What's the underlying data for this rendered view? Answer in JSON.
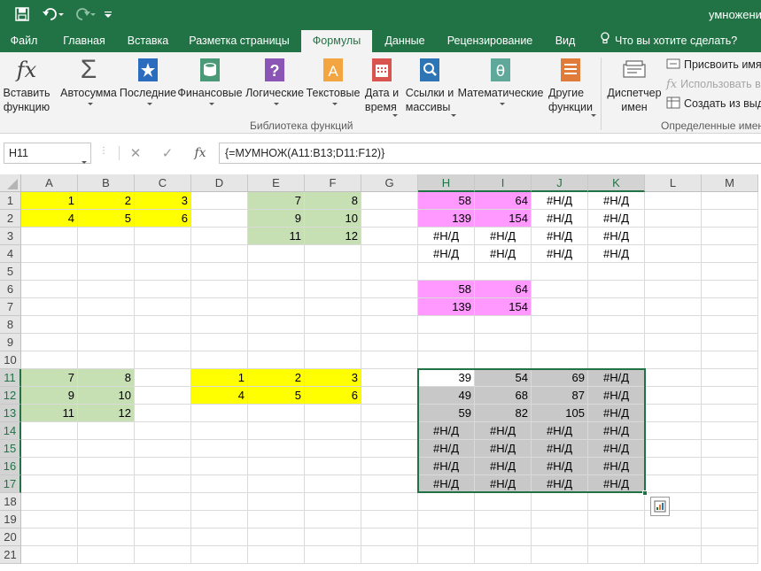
{
  "titlebar": {
    "doc_title": "умножени"
  },
  "tabs": [
    "Файл",
    "Главная",
    "Вставка",
    "Разметка страницы",
    "Формулы",
    "Данные",
    "Рецензирование",
    "Вид"
  ],
  "active_tab": "Формулы",
  "tell_me": "Что вы хотите сделать?",
  "ribbon": {
    "insert_function": "Вставить\nфункцию",
    "buttons": [
      {
        "id": "autosum",
        "label": "Автосумма",
        "icon": "sigma-icon"
      },
      {
        "id": "recent",
        "label": "Последние",
        "icon": "star-book-icon"
      },
      {
        "id": "financial",
        "label": "Финансовые",
        "icon": "coins-book-icon"
      },
      {
        "id": "logical",
        "label": "Логические",
        "icon": "question-book-icon"
      },
      {
        "id": "text",
        "label": "Текстовые",
        "icon": "letter-book-icon"
      },
      {
        "id": "datetime",
        "label": "Дата и\nвремя",
        "icon": "calendar-book-icon"
      },
      {
        "id": "lookup",
        "label": "Ссылки и\nмассивы",
        "icon": "magnifier-book-icon"
      },
      {
        "id": "math",
        "label": "Математические",
        "icon": "theta-book-icon"
      },
      {
        "id": "more",
        "label": "Другие\nфункции",
        "icon": "more-book-icon"
      }
    ],
    "library_group_label": "Библиотека функций",
    "name_manager": "Диспетчер\nимен",
    "define_name": "Присвоить имя",
    "use_in_formula": "Использовать в",
    "create_from_selection": "Создать из выде",
    "defined_names_group_label": "Определенные имена"
  },
  "formula_bar": {
    "name_box": "H11",
    "cancel_symbol": "✕",
    "enter_symbol": "✓",
    "fx_symbol": "fx",
    "formula": "{=МУМНОЖ(A11:B13;D11:F12)}"
  },
  "sheet": {
    "columns": [
      "A",
      "B",
      "C",
      "D",
      "E",
      "F",
      "G",
      "H",
      "I",
      "J",
      "K",
      "L",
      "M"
    ],
    "rows": [
      "1",
      "2",
      "3",
      "4",
      "5",
      "6",
      "7",
      "8",
      "9",
      "10",
      "11",
      "12",
      "13",
      "14",
      "15",
      "16",
      "17",
      "18",
      "19",
      "20",
      "21"
    ],
    "selected_columns": [
      "H",
      "I",
      "J",
      "K"
    ],
    "selected_rows": [
      "11",
      "12",
      "13",
      "14",
      "15",
      "16",
      "17"
    ],
    "cells": [
      {
        "ref": "A1",
        "v": "1",
        "fill": "yellow"
      },
      {
        "ref": "B1",
        "v": "2",
        "fill": "yellow"
      },
      {
        "ref": "C1",
        "v": "3",
        "fill": "yellow"
      },
      {
        "ref": "A2",
        "v": "4",
        "fill": "yellow"
      },
      {
        "ref": "B2",
        "v": "5",
        "fill": "yellow"
      },
      {
        "ref": "C2",
        "v": "6",
        "fill": "yellow"
      },
      {
        "ref": "E1",
        "v": "7",
        "fill": "green"
      },
      {
        "ref": "F1",
        "v": "8",
        "fill": "green"
      },
      {
        "ref": "E2",
        "v": "9",
        "fill": "green"
      },
      {
        "ref": "F2",
        "v": "10",
        "fill": "green"
      },
      {
        "ref": "E3",
        "v": "11",
        "fill": "green"
      },
      {
        "ref": "F3",
        "v": "12",
        "fill": "green"
      },
      {
        "ref": "H1",
        "v": "58",
        "fill": "pink"
      },
      {
        "ref": "I1",
        "v": "64",
        "fill": "pink"
      },
      {
        "ref": "J1",
        "v": "#Н/Д"
      },
      {
        "ref": "K1",
        "v": "#Н/Д"
      },
      {
        "ref": "H2",
        "v": "139",
        "fill": "pink"
      },
      {
        "ref": "I2",
        "v": "154",
        "fill": "pink"
      },
      {
        "ref": "J2",
        "v": "#Н/Д"
      },
      {
        "ref": "K2",
        "v": "#Н/Д"
      },
      {
        "ref": "H3",
        "v": "#Н/Д"
      },
      {
        "ref": "I3",
        "v": "#Н/Д"
      },
      {
        "ref": "J3",
        "v": "#Н/Д"
      },
      {
        "ref": "K3",
        "v": "#Н/Д"
      },
      {
        "ref": "H4",
        "v": "#Н/Д"
      },
      {
        "ref": "I4",
        "v": "#Н/Д"
      },
      {
        "ref": "J4",
        "v": "#Н/Д"
      },
      {
        "ref": "K4",
        "v": "#Н/Д"
      },
      {
        "ref": "H6",
        "v": "58",
        "fill": "pink"
      },
      {
        "ref": "I6",
        "v": "64",
        "fill": "pink"
      },
      {
        "ref": "H7",
        "v": "139",
        "fill": "pink"
      },
      {
        "ref": "I7",
        "v": "154",
        "fill": "pink"
      },
      {
        "ref": "A11",
        "v": "7",
        "fill": "green"
      },
      {
        "ref": "B11",
        "v": "8",
        "fill": "green"
      },
      {
        "ref": "A12",
        "v": "9",
        "fill": "green"
      },
      {
        "ref": "B12",
        "v": "10",
        "fill": "green"
      },
      {
        "ref": "A13",
        "v": "11",
        "fill": "green"
      },
      {
        "ref": "B13",
        "v": "12",
        "fill": "green"
      },
      {
        "ref": "D11",
        "v": "1",
        "fill": "yellow"
      },
      {
        "ref": "E11",
        "v": "2",
        "fill": "yellow"
      },
      {
        "ref": "F11",
        "v": "3",
        "fill": "yellow"
      },
      {
        "ref": "D12",
        "v": "4",
        "fill": "yellow"
      },
      {
        "ref": "E12",
        "v": "5",
        "fill": "yellow"
      },
      {
        "ref": "F12",
        "v": "6",
        "fill": "yellow"
      },
      {
        "ref": "H11",
        "v": "39",
        "fill": "white"
      },
      {
        "ref": "I11",
        "v": "54",
        "fill": "gray"
      },
      {
        "ref": "J11",
        "v": "69",
        "fill": "gray"
      },
      {
        "ref": "K11",
        "v": "#Н/Д",
        "fill": "gray"
      },
      {
        "ref": "H12",
        "v": "49",
        "fill": "gray"
      },
      {
        "ref": "I12",
        "v": "68",
        "fill": "gray"
      },
      {
        "ref": "J12",
        "v": "87",
        "fill": "gray"
      },
      {
        "ref": "K12",
        "v": "#Н/Д",
        "fill": "gray"
      },
      {
        "ref": "H13",
        "v": "59",
        "fill": "gray"
      },
      {
        "ref": "I13",
        "v": "82",
        "fill": "gray"
      },
      {
        "ref": "J13",
        "v": "105",
        "fill": "gray"
      },
      {
        "ref": "K13",
        "v": "#Н/Д",
        "fill": "gray"
      },
      {
        "ref": "H14",
        "v": "#Н/Д",
        "fill": "gray"
      },
      {
        "ref": "I14",
        "v": "#Н/Д",
        "fill": "gray"
      },
      {
        "ref": "J14",
        "v": "#Н/Д",
        "fill": "gray"
      },
      {
        "ref": "K14",
        "v": "#Н/Д",
        "fill": "gray"
      },
      {
        "ref": "H15",
        "v": "#Н/Д",
        "fill": "gray"
      },
      {
        "ref": "I15",
        "v": "#Н/Д",
        "fill": "gray"
      },
      {
        "ref": "J15",
        "v": "#Н/Д",
        "fill": "gray"
      },
      {
        "ref": "K15",
        "v": "#Н/Д",
        "fill": "gray"
      },
      {
        "ref": "H16",
        "v": "#Н/Д",
        "fill": "gray"
      },
      {
        "ref": "I16",
        "v": "#Н/Д",
        "fill": "gray"
      },
      {
        "ref": "J16",
        "v": "#Н/Д",
        "fill": "gray"
      },
      {
        "ref": "K16",
        "v": "#Н/Д",
        "fill": "gray"
      },
      {
        "ref": "H17",
        "v": "#Н/Д",
        "fill": "gray"
      },
      {
        "ref": "I17",
        "v": "#Н/Д",
        "fill": "gray"
      },
      {
        "ref": "J17",
        "v": "#Н/Д",
        "fill": "gray"
      },
      {
        "ref": "K17",
        "v": "#Н/Д",
        "fill": "gray"
      }
    ],
    "selection": {
      "from": "H11",
      "to": "K17"
    }
  },
  "colors": {
    "brand": "#217346",
    "yellow": "#ffff00",
    "green": "#c6e0b4",
    "pink": "#ff99ff",
    "gray": "#c8c8c8",
    "white": "#ffffff"
  }
}
